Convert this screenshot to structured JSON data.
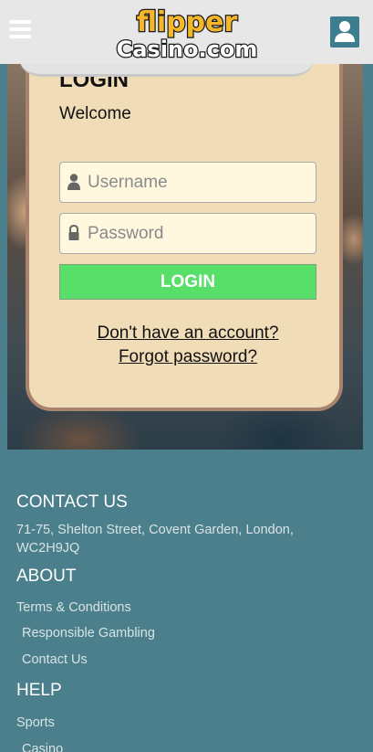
{
  "header": {
    "logo_line1": "flipper",
    "logo_line2": "Casino.com",
    "menu_icon": "hamburger-menu-icon",
    "user_icon": "user-icon"
  },
  "login": {
    "title": "LOGIN",
    "welcome": "Welcome",
    "username_placeholder": "Username",
    "username_icon": "user-icon",
    "password_placeholder": "Password",
    "password_icon": "lock-icon",
    "button_label": "LOGIN",
    "signup_link": "Don't have an account?",
    "forgot_link": "Forgot password?"
  },
  "footer": {
    "contact_heading": "CONTACT US",
    "address": "71-75, Shelton Street, Covent Garden, London, WC2H9JQ",
    "about_heading": "ABOUT",
    "about_links": [
      "Terms & Conditions",
      "Responsible Gambling",
      "Contact Us"
    ],
    "help_heading": "HELP",
    "help_links": [
      "Sports",
      "Casino"
    ]
  },
  "colors": {
    "header_bg": "#e7e7e7",
    "card_bg": "#f1dcb8",
    "card_border": "#a8836e",
    "input_bg": "#fff8df",
    "login_button": "#58df6a",
    "footer_bg": "#4a7f8b",
    "user_button_bg": "#3e7d8d",
    "logo_yellow": "#f5b72a"
  }
}
